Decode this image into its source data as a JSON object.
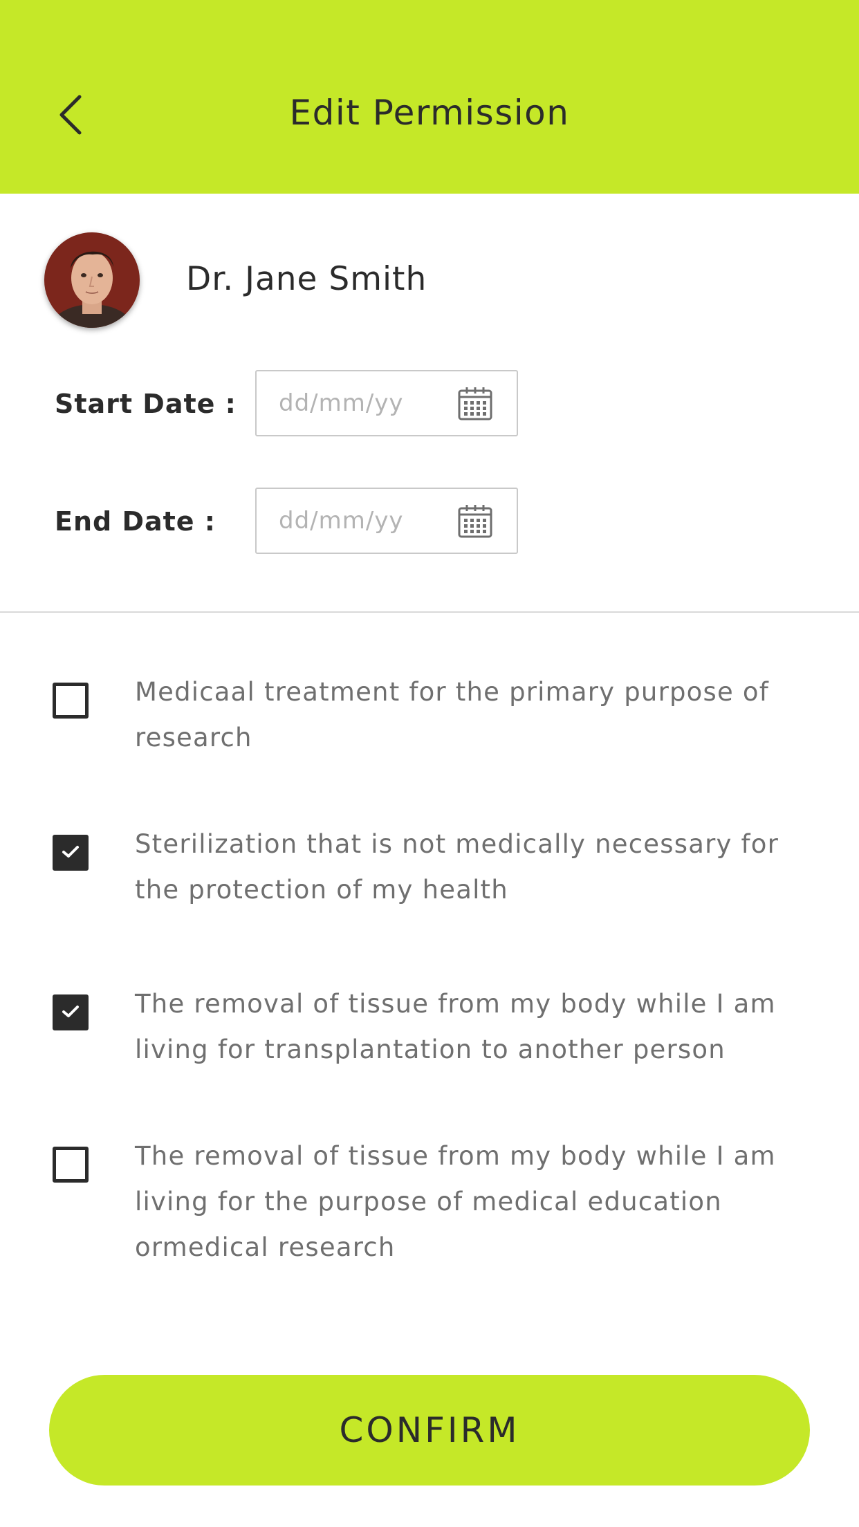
{
  "header": {
    "title": "Edit Permission",
    "background": "#c5e828",
    "back_icon": "chevron-left-icon"
  },
  "profile": {
    "name": "Dr. Jane Smith",
    "avatar_icon": "avatar"
  },
  "dates": {
    "start_label": "Start Date :",
    "start_placeholder": "dd/mm/yy",
    "start_value": "",
    "end_label": "End Date :",
    "end_placeholder": "dd/mm/yy",
    "end_value": "",
    "icon": "calendar-icon"
  },
  "options": [
    {
      "text": "Medicaal treatment for the primary purpose of research",
      "checked": false
    },
    {
      "text": "Sterilization that is not medically necessary for the protection of my health",
      "checked": true
    },
    {
      "text": "The removal of tissue from my body while I am living for transplantation to another person",
      "checked": true
    },
    {
      "text": "The removal of tissue from my body while I am living for the purpose of medical education ormedical research",
      "checked": false
    }
  ],
  "confirm_label": "CONFIRM",
  "colors": {
    "accent": "#c5e828",
    "checkbox": "#2b2b2b",
    "option_text": "#6f6f6f"
  }
}
